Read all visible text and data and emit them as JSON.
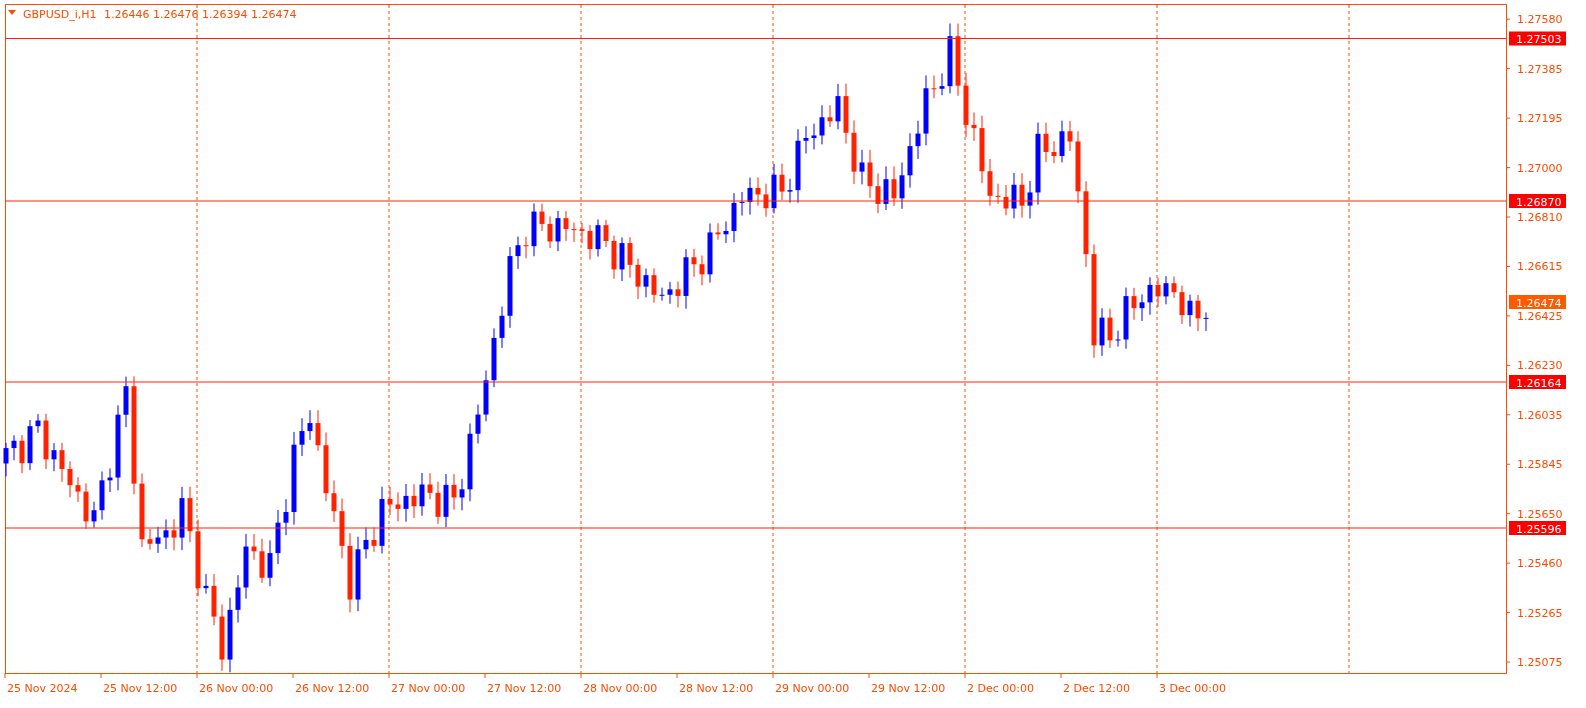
{
  "header": {
    "symbol": "GBPUSD_i,H1",
    "values": "1.26446 1.26476 1.26394 1.26474"
  },
  "price_axis": [
    "1.27580",
    "1.27385",
    "1.27195",
    "1.27000",
    "1.26810",
    "1.26615",
    "1.26425",
    "1.26230",
    "1.26035",
    "1.25845",
    "1.25650",
    "1.25460",
    "1.25265",
    "1.25075"
  ],
  "price_lines": [
    {
      "kind": "level",
      "label": "1.27503"
    },
    {
      "kind": "level",
      "label": "1.26870"
    },
    {
      "kind": "current",
      "label": "1.26474"
    },
    {
      "kind": "level",
      "label": "1.26164"
    },
    {
      "kind": "level",
      "label": "1.25596"
    }
  ],
  "time_axis": [
    "25 Nov 2024",
    "25 Nov 12:00",
    "26 Nov 00:00",
    "26 Nov 12:00",
    "27 Nov 00:00",
    "27 Nov 12:00",
    "28 Nov 00:00",
    "28 Nov 12:00",
    "29 Nov 00:00",
    "29 Nov 12:00",
    "2 Dec 00:00",
    "2 Dec 12:00",
    "3 Dec 00:00"
  ]
}
